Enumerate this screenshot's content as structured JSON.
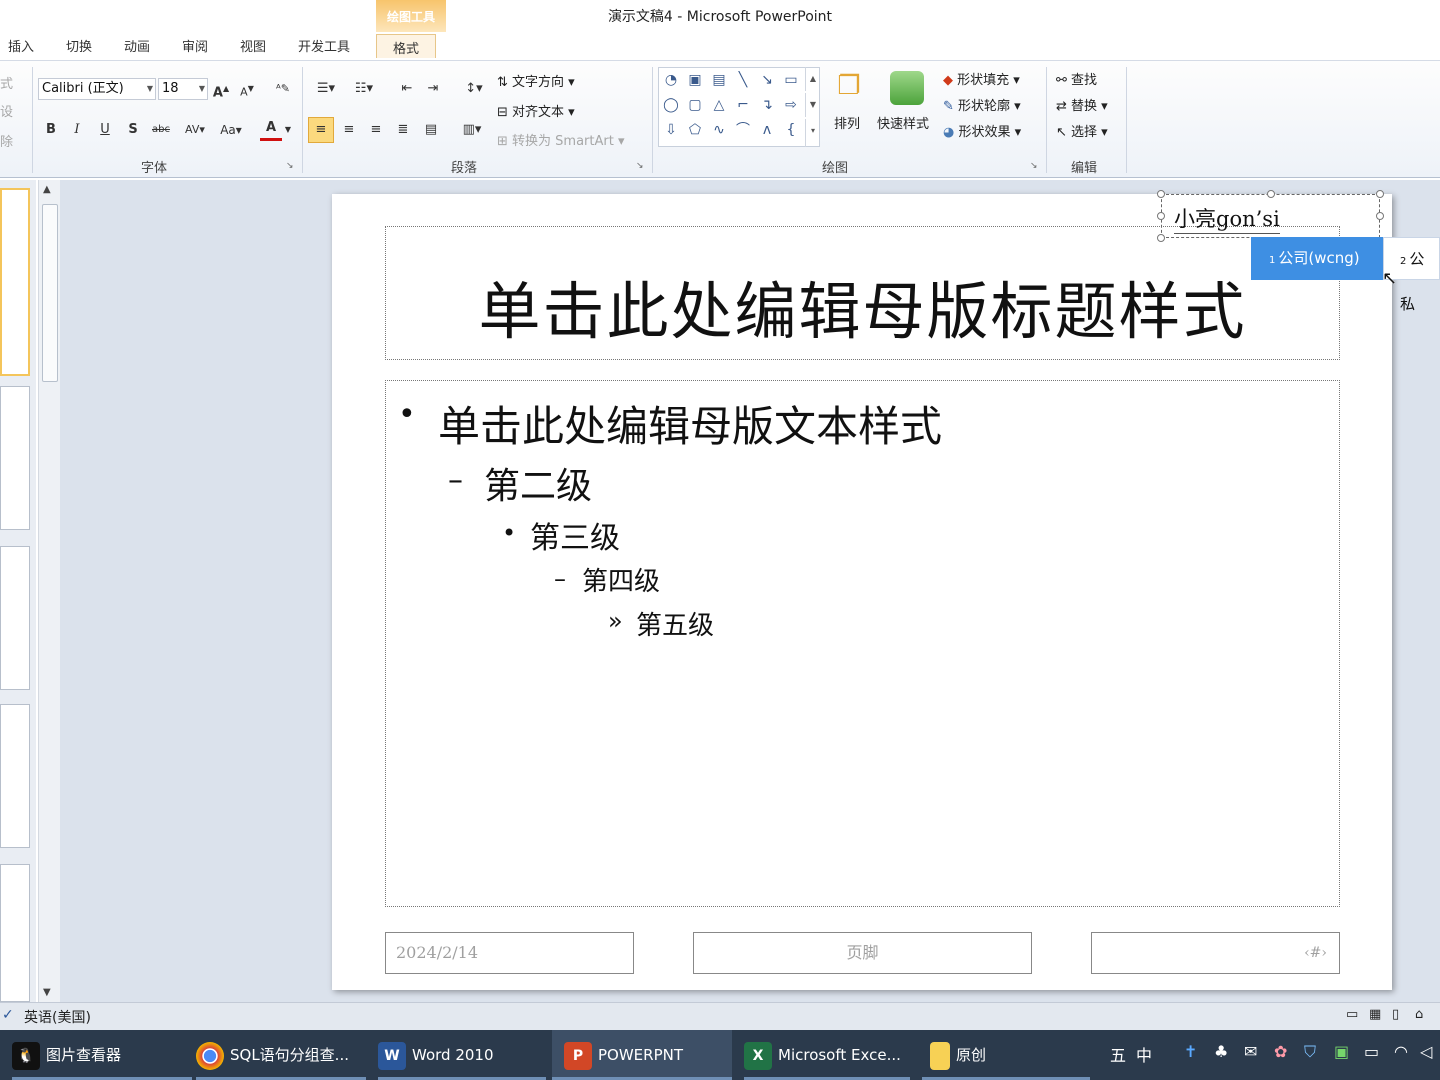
{
  "window": {
    "title": "演示文稿4 - Microsoft PowerPoint",
    "context_tab": "绘图工具"
  },
  "tabs": [
    "插入",
    "切换",
    "动画",
    "审阅",
    "视图",
    "开发工具",
    "格式"
  ],
  "ribbon": {
    "left_partial": [
      "式",
      "设",
      "除"
    ],
    "font": {
      "name": "Calibri (正文)",
      "size": "18",
      "group_label": "字体",
      "bold": "B",
      "italic": "I",
      "underline": "U",
      "shadow": "S",
      "strike": "abc",
      "spacing": "AV",
      "case": "Aa",
      "font_color": "A",
      "grow": "A",
      "shrink": "A"
    },
    "paragraph": {
      "text_direction": "文字方向",
      "align_text": "对齐文本",
      "smartart": "转换为 SmartArt",
      "group_label": "段落"
    },
    "drawing": {
      "arrange": "排列",
      "quick_styles": "快速样式",
      "fill": "形状填充",
      "outline": "形状轮廓",
      "effects": "形状效果",
      "group_label": "绘图"
    },
    "editing": {
      "find": "查找",
      "replace": "替换",
      "select": "选择",
      "group_label": "编辑"
    }
  },
  "slide": {
    "title": "单击此处编辑母版标题样式",
    "levels": [
      {
        "bullet": "•",
        "text": "单击此处编辑母版文本样式"
      },
      {
        "bullet": "–",
        "text": "第二级"
      },
      {
        "bullet": "•",
        "text": "第三级"
      },
      {
        "bullet": "–",
        "text": "第四级"
      },
      {
        "bullet": "»",
        "text": "第五级"
      }
    ],
    "footer_date": "2024/2/14",
    "footer_text": "页脚",
    "footer_num": "‹#›"
  },
  "textbox": {
    "text": "小亮gon’si"
  },
  "ime": {
    "candidates": [
      {
        "num": "1",
        "text": "公司(wcng)"
      },
      {
        "num": "2",
        "text": "公私"
      }
    ]
  },
  "status": {
    "language": "英语(美国)"
  },
  "taskbar": {
    "items": [
      {
        "label": "图片查看器",
        "icon": "qq-icon"
      },
      {
        "label": "SQL语句分组查...",
        "icon": "chrome-icon"
      },
      {
        "label": "Word 2010",
        "icon": "word-icon"
      },
      {
        "label": "POWERPNT",
        "icon": "powerpoint-icon"
      },
      {
        "label": "Microsoft Exce...",
        "icon": "excel-icon"
      },
      {
        "label": "原创",
        "icon": "folder-icon"
      }
    ],
    "ime_mode": "五",
    "ime_lang": "中"
  },
  "colors": {
    "accent_ime": "#3e8fe3",
    "taskbar": "#2b3a4c",
    "ppt": "#d24726",
    "word": "#2b579a",
    "excel": "#217346"
  }
}
